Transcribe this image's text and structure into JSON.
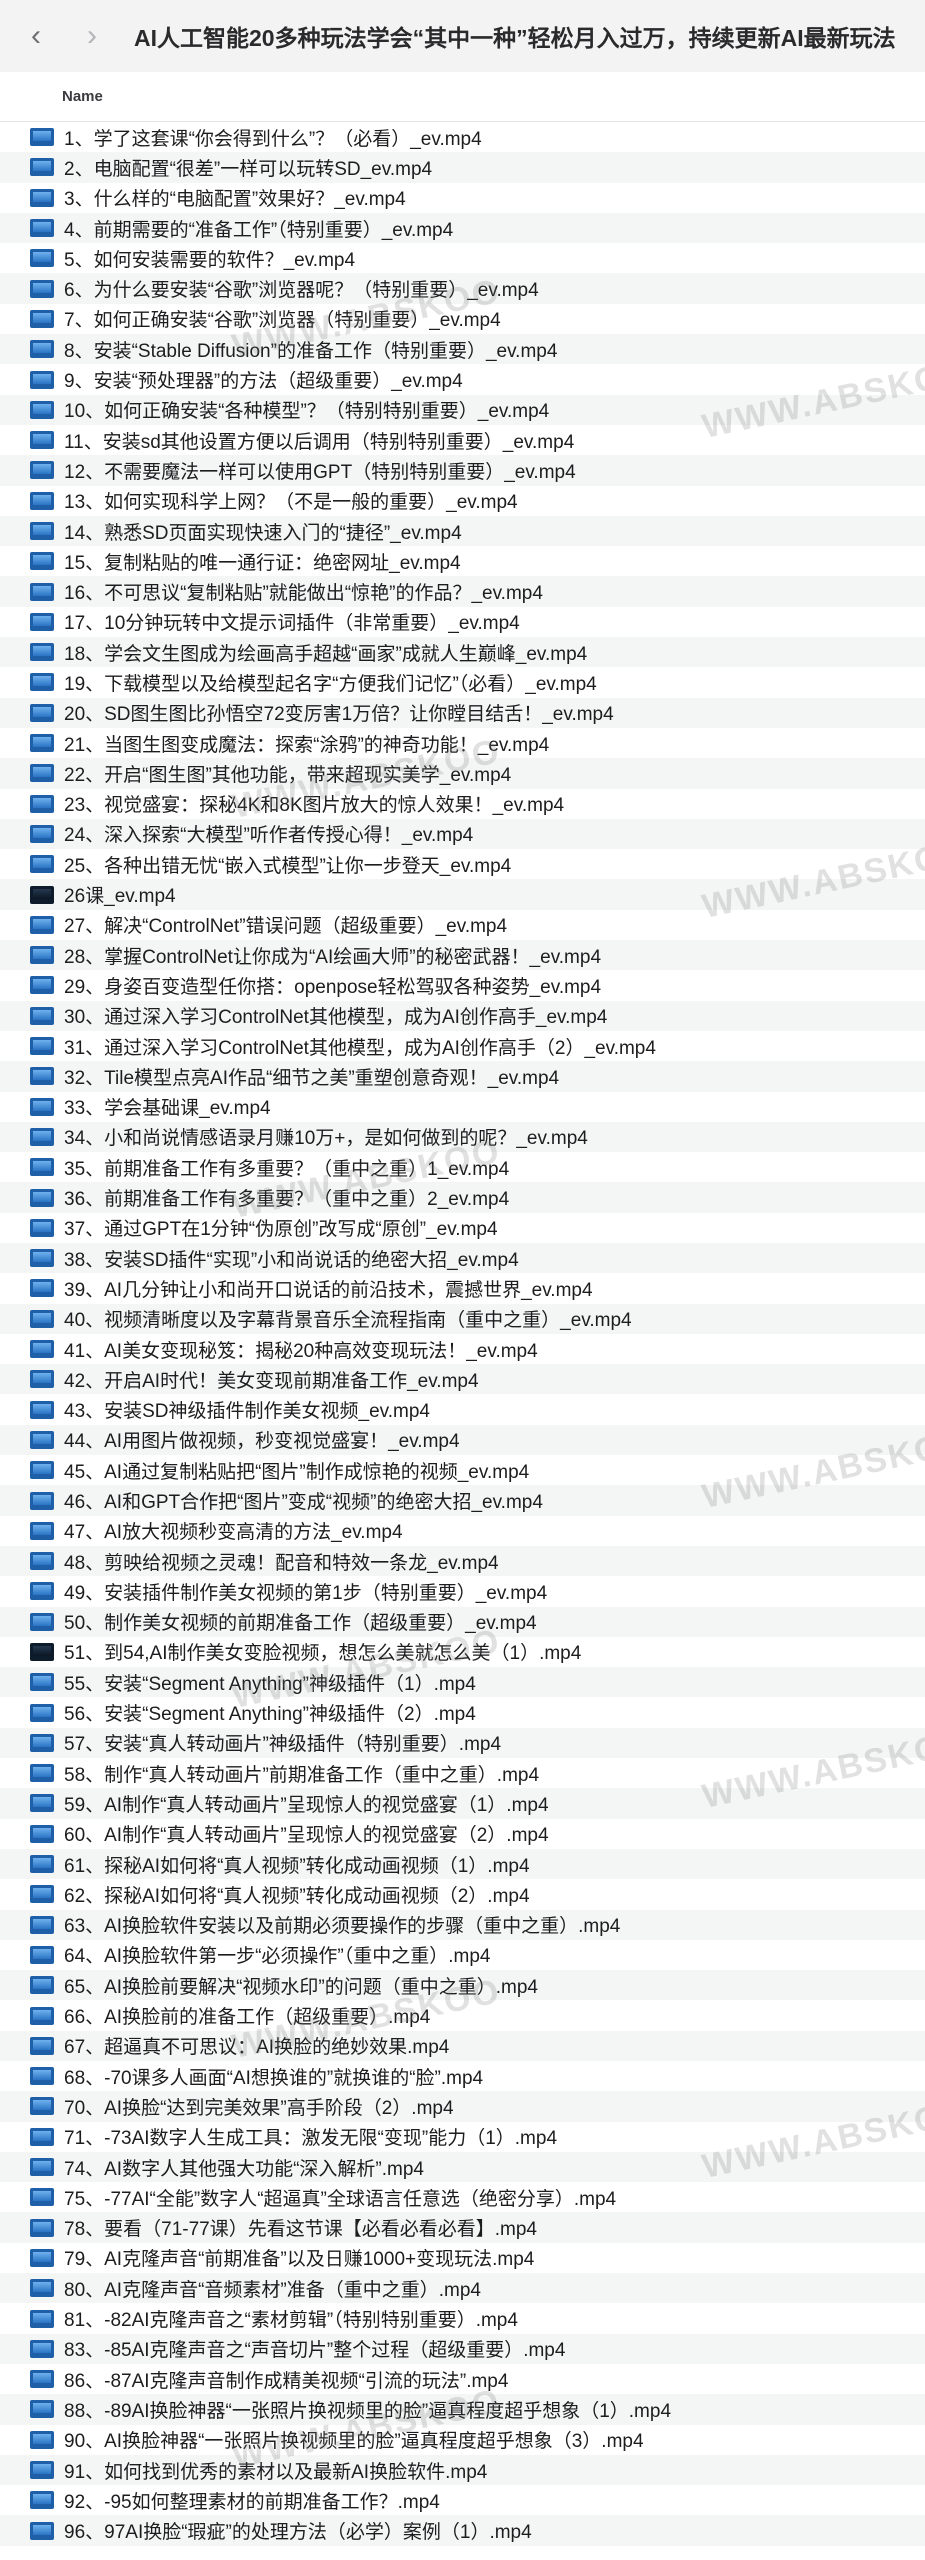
{
  "window": {
    "title": "AI人工智能20多种玩法学会“其中一种”轻松月入过万，持续更新AI最新玩法"
  },
  "toolbar": {
    "back_icon": "‹",
    "forward_icon": "›"
  },
  "list": {
    "column_header": "Name",
    "files": [
      "1、学了这套课“你会得到什么”？（必看）_ev.mp4",
      "2、电脑配置“很差”一样可以玩转SD_ev.mp4",
      "3、什么样的“电脑配置”效果好？_ev.mp4",
      "4、前期需要的“准备工作”（特别重要）_ev.mp4",
      "5、如何安装需要的软件？_ev.mp4",
      "6、为什么要安装“谷歌”浏览器呢？（特别重要）_ev.mp4",
      "7、如何正确安装“谷歌”浏览器（特别重要）_ev.mp4",
      "8、安装“Stable Diffusion”的准备工作（特别重要）_ev.mp4",
      "9、安装“预处理器”的方法（超级重要）_ev.mp4",
      "10、如何正确安装“各种模型”？（特别特别重要）_ev.mp4",
      "11、安装sd其他设置方便以后调用（特别特别重要）_ev.mp4",
      "12、不需要魔法一样可以使用GPT（特别特别重要）_ev.mp4",
      "13、如何实现科学上网？（不是一般的重要）_ev.mp4",
      "14、熟悉SD页面实现快速入门的“捷径”_ev.mp4",
      "15、复制粘贴的唯一通行证：绝密网址_ev.mp4",
      "16、不可思议“复制粘贴”就能做出“惊艳”的作品？_ev.mp4",
      "17、10分钟玩转中文提示词插件（非常重要）_ev.mp4",
      "18、学会文生图成为绘画高手超越“画家”成就人生巅峰_ev.mp4",
      "19、下载模型以及给模型起名字“方便我们记忆”（必看）_ev.mp4",
      "20、SD图生图比孙悟空72变厉害1万倍？让你瞠目结舌！_ev.mp4",
      "21、当图生图变成魔法：探索“涂鸦”的神奇功能！_ev.mp4",
      "22、开启“图生图”其他功能，带来超现实美学_ev.mp4",
      "23、视觉盛宴：探秘4K和8K图片放大的惊人效果！_ev.mp4",
      "24、深入探索“大模型”听作者传授心得！_ev.mp4",
      "25、各种出错无忧“嵌入式模型”让你一步登天_ev.mp4",
      "26课_ev.mp4",
      "27、解决“ControlNet”错误问题（超级重要）_ev.mp4",
      "28、掌握ControlNet让你成为“AI绘画大师”的秘密武器！_ev.mp4",
      "29、身姿百变造型任你搭：openpose轻松驾驭各种姿势_ev.mp4",
      "30、通过深入学习ControlNet其他模型，成为AI创作高手_ev.mp4",
      "31、通过深入学习ControlNet其他模型，成为AI创作高手（2）_ev.mp4",
      "32、Tile模型点亮AI作品“细节之美”重塑创意奇观！_ev.mp4",
      "33、学会基础课_ev.mp4",
      "34、小和尚说情感语录月赚10万+，是如何做到的呢？_ev.mp4",
      "35、前期准备工作有多重要？（重中之重）1_ev.mp4",
      "36、前期准备工作有多重要？（重中之重）2_ev.mp4",
      "37、通过GPT在1分钟“伪原创”改写成“原创”_ev.mp4",
      "38、安装SD插件“实现”小和尚说话的绝密大招_ev.mp4",
      "39、AI几分钟让小和尚开口说话的前沿技术，震撼世界_ev.mp4",
      "40、视频清晰度以及字幕背景音乐全流程指南（重中之重）_ev.mp4",
      "41、AI美女变现秘笈：揭秘20种高效变现玩法！_ev.mp4",
      "42、开启AI时代！美女变现前期准备工作_ev.mp4",
      "43、安装SD神级插件制作美女视频_ev.mp4",
      "44、AI用图片做视频，秒变视觉盛宴！_ev.mp4",
      "45、AI通过复制粘贴把“图片”制作成惊艳的视频_ev.mp4",
      "46、AI和GPT合作把“图片”变成“视频”的绝密大招_ev.mp4",
      "47、AI放大视频秒变高清的方法_ev.mp4",
      "48、剪映给视频之灵魂！配音和特效一条龙_ev.mp4",
      "49、安装插件制作美女视频的第1步（特别重要）_ev.mp4",
      "50、制作美女视频的前期准备工作（超级重要）_ev.mp4",
      "51、到54,AI制作美女变脸视频，想怎么美就怎么美（1）.mp4",
      "55、安装“Segment Anything”神级插件（1）.mp4",
      "56、安装“Segment Anything”神级插件（2）.mp4",
      "57、安装“真人转动画片”神级插件（特别重要）.mp4",
      "58、制作“真人转动画片”前期准备工作（重中之重）.mp4",
      "59、AI制作“真人转动画片”呈现惊人的视觉盛宴（1）.mp4",
      "60、AI制作“真人转动画片”呈现惊人的视觉盛宴（2）.mp4",
      "61、探秘AI如何将“真人视频”转化成动画视频（1）.mp4",
      "62、探秘AI如何将“真人视频”转化成动画视频（2）.mp4",
      "63、AI换脸软件安装以及前期必须要操作的步骤（重中之重）.mp4",
      "64、AI换脸软件第一步“必须操作”（重中之重）.mp4",
      "65、AI换脸前要解决“视频水印”的问题（重中之重）.mp4",
      "66、AI换脸前的准备工作（超级重要）.mp4",
      "67、超逼真不可思议：AI换脸的绝妙效果.mp4",
      "68、-70课多人画面“AI想换谁的”就换谁的“脸”.mp4",
      "70、AI换脸“达到完美效果”高手阶段（2）.mp4",
      "71、-73AI数字人生成工具：激发无限“变现”能力（1）.mp4",
      "74、AI数字人其他强大功能“深入解析”.mp4",
      "75、-77AI“全能”数字人“超逼真”全球语言任意选（绝密分享）.mp4",
      "78、要看（71-77课）先看这节课【必看必看必看】.mp4",
      "79、AI克隆声音“前期准备”以及日赚1000+变现玩法.mp4",
      "80、AI克隆声音“音频素材”准备（重中之重）.mp4",
      "81、-82AI克隆声音之“素材剪辑”（特别特别重要）.mp4",
      "83、-85AI克隆声音之“声音切片”整个过程（超级重要）.mp4",
      "86、-87AI克隆声音制作成精美视频“引流的玩法”.mp4",
      "88、-89AI换脸神器“一张照片换视频里的脸”逼真程度超乎想象（1）.mp4",
      "90、AI换脸神器“一张照片换视频里的脸”逼真程度超乎想象（3）.mp4",
      "91、如何找到优秀的素材以及最新AI换脸软件.mp4",
      "92、-95如何整理素材的前期准备工作？.mp4",
      "96、97AI换脸“瑕疵”的处理方法（必学）案例（1）.mp4"
    ],
    "dark_icon_rows": [
      26,
      51
    ]
  },
  "watermark": {
    "text": "WWW.ABSKOO"
  }
}
